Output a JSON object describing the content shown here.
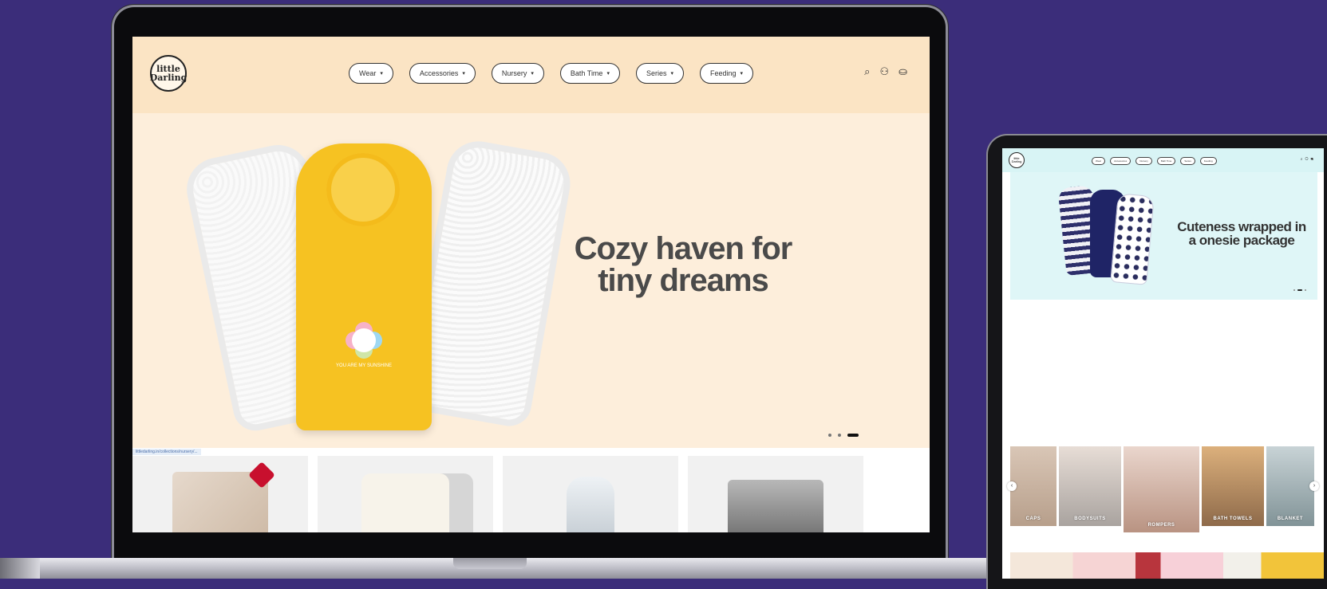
{
  "laptop": {
    "logo_text": "little Darling",
    "nav": [
      {
        "label": "Wear"
      },
      {
        "label": "Accessories"
      },
      {
        "label": "Nursery"
      },
      {
        "label": "Bath Time"
      },
      {
        "label": "Series"
      },
      {
        "label": "Feeding"
      }
    ],
    "icons": {
      "search": "search-icon",
      "account": "account-icon",
      "cart": "cart-icon"
    },
    "hero": {
      "title": "Cozy haven for tiny dreams",
      "product_text": "YOU ARE MY SUNSHINE",
      "slide_count": 3,
      "active_slide": 3
    },
    "status_url": "littledarling.in/collections/nursery/..."
  },
  "tablet": {
    "logo_text": "little Darling",
    "nav": [
      {
        "label": "Wear"
      },
      {
        "label": "Accessories"
      },
      {
        "label": "Nursery"
      },
      {
        "label": "Bath Time"
      },
      {
        "label": "Series"
      },
      {
        "label": "Feeding"
      }
    ],
    "hero": {
      "title": "Cuteness wrapped in a onesie package"
    },
    "categories": [
      {
        "label": "CAPS"
      },
      {
        "label": "BODYSUITS"
      },
      {
        "label": "ROMPERS"
      },
      {
        "label": "BATH TOWELS"
      },
      {
        "label": "BLANKET"
      }
    ]
  },
  "colors": {
    "background": "#3b2d7a",
    "laptop_header": "#fbe4c4",
    "laptop_hero": "#fdeedb",
    "tablet_header": "#d8f4f5",
    "accent_yellow": "#f6c222"
  }
}
